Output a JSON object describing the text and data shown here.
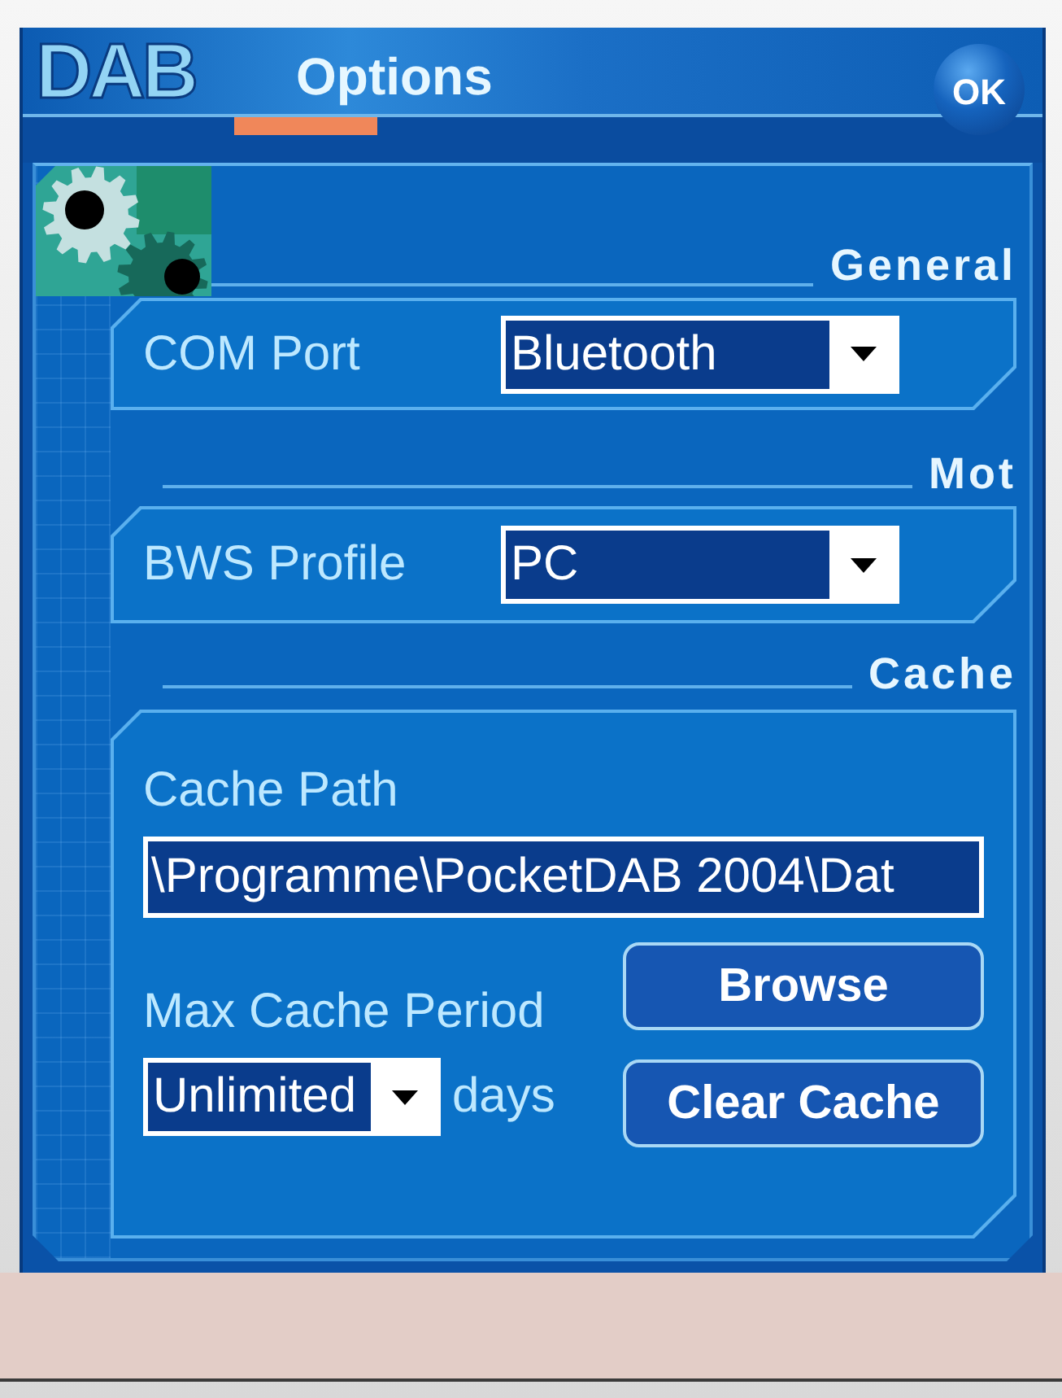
{
  "header": {
    "logo": "DAB",
    "ok_button": "OK"
  },
  "tabs": [
    {
      "label": "Options",
      "selected": true
    }
  ],
  "sections": [
    {
      "kind": "dropdown",
      "heading": "General",
      "label": "COM Port",
      "value": "Bluetooth",
      "highlighted": true
    },
    {
      "kind": "dropdown",
      "heading": "Mot",
      "label": "BWS Profile",
      "value": "PC",
      "highlighted": true
    },
    {
      "kind": "cache",
      "heading": "Cache",
      "path_label": "Cache Path",
      "path_value": "\\Programme\\PocketDAB 2004\\Dat",
      "path_highlighted": true,
      "period_label": "Max Cache Period",
      "period_value": "Unlimited",
      "period_highlighted": true,
      "period_unit": "days",
      "buttons": [
        "Browse",
        "Clear Cache"
      ]
    }
  ]
}
